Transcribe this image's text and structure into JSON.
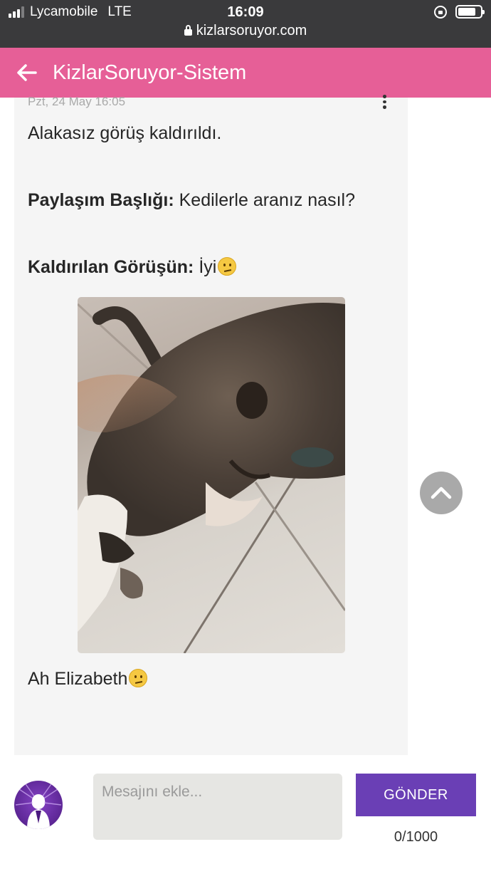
{
  "status_bar": {
    "carrier": "Lycamobile",
    "network": "LTE",
    "time": "16:09",
    "url": "kizlarsoruyor.com",
    "signal_bars": 3,
    "battery_level": 0.8
  },
  "app_bar": {
    "title": "KizlarSoruyor-Sistem",
    "back_icon": "arrow-left-icon",
    "color": "#e65f97"
  },
  "message": {
    "date": "Pzt, 24 May 16:05",
    "intro": "Alakasız görüş kaldırıldı.",
    "post_title_label": "Paylaşım Başlığı:",
    "post_title_value": "Kedilerle aranız nasıl?",
    "removed_label": "Kaldırılan Görüşün:",
    "removed_value": "İyi",
    "caption": "Ah Elizabeth",
    "emoji": "confused-face-icon"
  },
  "composer": {
    "placeholder": "Mesajını ekle...",
    "send_label": "GÖNDER",
    "counter": "0/1000",
    "send_color": "#6a3fb5"
  }
}
